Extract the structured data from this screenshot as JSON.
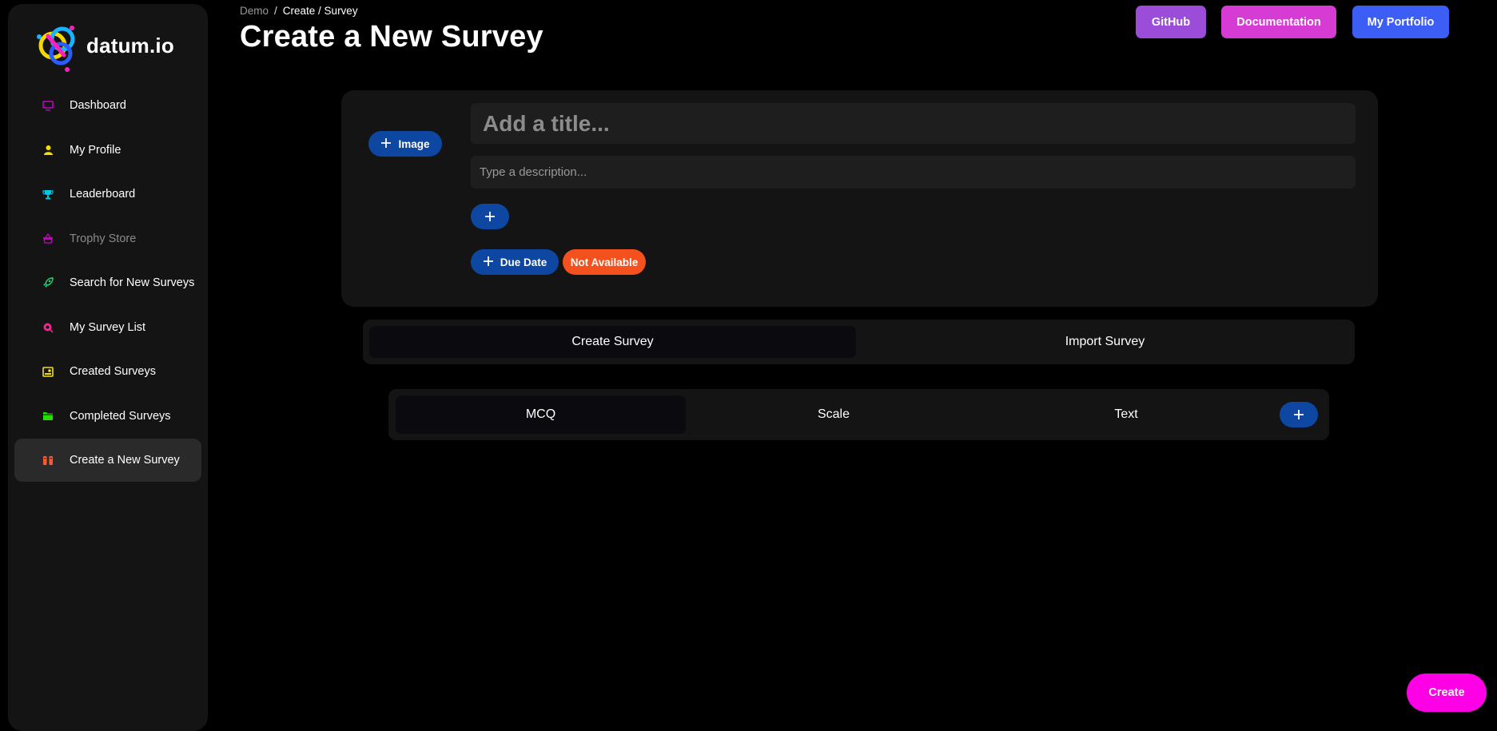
{
  "brand": {
    "name": "datum.io"
  },
  "sidebar": {
    "items": [
      {
        "label": "Dashboard",
        "icon": "monitor-icon",
        "color": "#c400c4"
      },
      {
        "label": "My Profile",
        "icon": "user-icon",
        "color": "#f5e000"
      },
      {
        "label": "Leaderboard",
        "icon": "trophy-icon",
        "color": "#00c8e0"
      },
      {
        "label": "Trophy Store",
        "icon": "basket-icon",
        "color": "#c400c4"
      },
      {
        "label": "Search for New Surveys",
        "icon": "rocket-icon",
        "color": "#1ee07a"
      },
      {
        "label": "My Survey List",
        "icon": "list-icon",
        "color": "#ff1f8e"
      },
      {
        "label": "Created Surveys",
        "icon": "id-card-icon",
        "color": "#f5e000"
      },
      {
        "label": "Completed Surveys",
        "icon": "folder-icon",
        "color": "#22e000"
      },
      {
        "label": "Create a New Survey",
        "icon": "columns-icon",
        "color": "#ff5a2e"
      }
    ],
    "active_index": 8,
    "disabled_index": 3
  },
  "header": {
    "breadcrumb": {
      "root": "Demo",
      "separator": "/",
      "current": "Create / Survey"
    },
    "title": "Create a New Survey",
    "buttons": {
      "github": "GitHub",
      "docs": "Documentation",
      "portfolio": "My Portfolio"
    }
  },
  "survey_card": {
    "image_button": "Image",
    "title_placeholder": "Add a title...",
    "description_placeholder": "Type a description...",
    "due_date_button": "Due Date",
    "due_date_status": "Not Available"
  },
  "mode_tabs": {
    "create": "Create Survey",
    "import": "Import Survey",
    "active": "create"
  },
  "question_tabs": {
    "mcq": "MCQ",
    "scale": "Scale",
    "text": "Text",
    "active": "mcq"
  },
  "actions": {
    "create": "Create"
  },
  "colors": {
    "accent_blue": "#0d47a1",
    "github": "#9b4dd9",
    "docs": "#d63bd4",
    "portfolio": "#3d5ef5",
    "create": "#ff00e6",
    "not_available": "#f4511e"
  }
}
